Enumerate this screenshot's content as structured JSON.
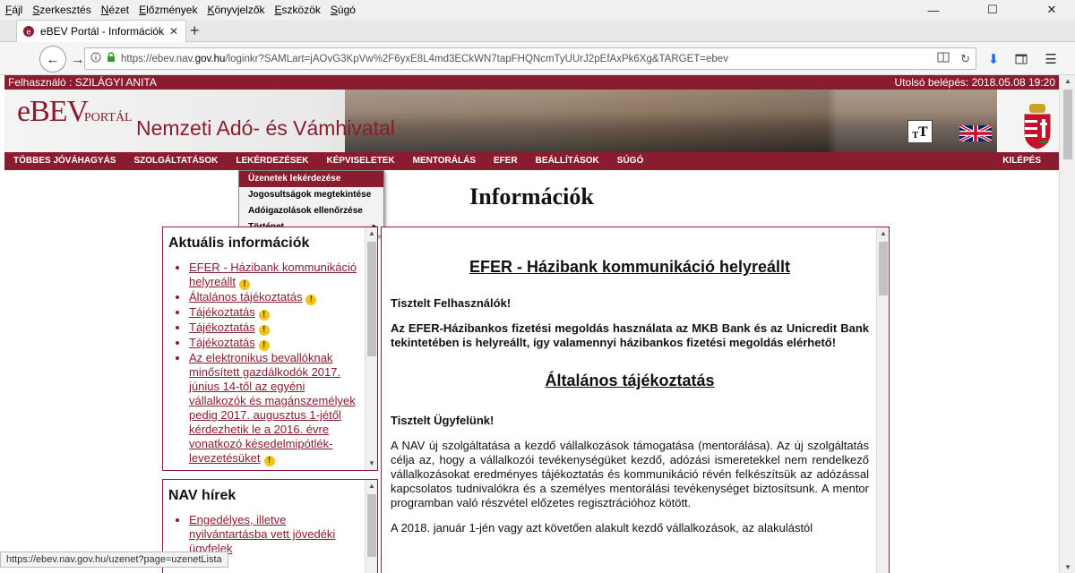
{
  "menubar": {
    "items": [
      {
        "pre": "",
        "key": "F",
        "post": "ájl"
      },
      {
        "pre": "",
        "key": "S",
        "post": "zerkesztés"
      },
      {
        "pre": "",
        "key": "N",
        "post": "ézet"
      },
      {
        "pre": "",
        "key": "E",
        "post": "lőzmények"
      },
      {
        "pre": "",
        "key": "K",
        "post": "önyvjelzők"
      },
      {
        "pre": "",
        "key": "E",
        "post": "szközök"
      },
      {
        "pre": "",
        "key": "S",
        "post": "úgó"
      }
    ],
    "minimize": "—",
    "maximize": "☐",
    "close": "✕"
  },
  "tabbar": {
    "tab_title": "eBEV Portál - Információk",
    "close": "✕",
    "new_tab": "+"
  },
  "navbar": {
    "back": "←",
    "forward": "→",
    "url_prefix": "https://ebev.nav.",
    "url_domain": "gov.hu",
    "url_rest": "/loginkr?SAMLart=jAOvG3KpVw%2F6yxE8L4md3ECkWN7tapFHQNcmTyUUrJ2pEfAxPk6Xg&TARGET=ebev",
    "reload": "↻",
    "download": "⬇",
    "menu": "☰"
  },
  "userbar": {
    "user": "Felhasználó : SZILÁGYI ANITA",
    "last_login": "Utolsó belépés: 2018.05.08 19:20"
  },
  "banner": {
    "logo_main": "eBEV",
    "logo_sub": "PORTÁL",
    "title": "Nemzeti Adó- és Vámhivatal",
    "tt_small": "T",
    "tt_big": "T"
  },
  "mainnav": {
    "items": [
      "TÖBBES JÓVÁHAGYÁS",
      "SZOLGÁLTATÁSOK",
      "LEKÉRDEZÉSEK",
      "KÉPVISELETEK",
      "MENTORÁLÁS",
      "EFER",
      "BEÁLLÍTÁSOK",
      "SÚGÓ"
    ],
    "logout": "KILÉPÉS"
  },
  "dropdown": {
    "items": [
      "Üzenetek lekérdezése",
      "Jogosultságok megtekintése",
      "Adóigazolások ellenőrzése",
      "Történet"
    ],
    "submenu_arrow": "▶"
  },
  "page_title": "Információk",
  "aktualis": {
    "heading": "Aktuális információk",
    "items": [
      "EFER - Házibank kommunikáció helyreállt",
      "Általános tájékoztatás",
      "Tájékoztatás",
      "Tájékoztatás",
      "Tájékoztatás",
      "Az elektronikus bevallóknak minősített gazdálkodók 2017. június 14-től az egyéni vállalkozók és magánszemélyek pedig 2017. augusztus 1-jétől kérdezhetik le a 2016. évre vonatkozó késedelmipótlék-levezetésüket"
    ]
  },
  "nav_hirek": {
    "heading": "NAV hírek",
    "items": [
      "Engedélyes, illetve nyilvántartásba vett jövedéki ügyfelek"
    ]
  },
  "article": {
    "h1": "EFER - Házibank kommunikáció helyreállt",
    "p1": "Tisztelt Felhasználók!",
    "p2": "Az EFER-Házibankos fizetési megoldás használata az MKB Bank és az Unicredit Bank tekintetében is helyreállt, így valamennyi házibankos fizetési megoldás elérhető!",
    "h2": "Általános tájékoztatás",
    "p3": "Tisztelt Ügyfelünk!",
    "p4": "A NAV új szolgáltatása a kezdő vállalkozások támogatása (mentorálása). Az új szolgáltatás célja az, hogy a vállalkozói tevékenységüket kezdő, adózási ismeretekkel nem rendelkező vállalkozásokat eredményes tájékoztatás és kommunikáció révén felkészítsük az adózással kapcsolatos tudnivalókra és a személyes mentorálási tevékenységet biztosítsunk. A mentor programban való részvétel előzetes regisztrációhoz kötött.",
    "p5": "A 2018. január 1-jén vagy azt követően alakult kezdő vállalkozások, az alakulástól"
  },
  "scroll": {
    "up": "▲",
    "down": "▼"
  },
  "warn_glyph": "!",
  "statusbar": "https://ebev.nav.gov.hu/uzenet?page=uzenetLista",
  "colors": {
    "brand": "#8a1c30",
    "warning": "#f0c419"
  }
}
